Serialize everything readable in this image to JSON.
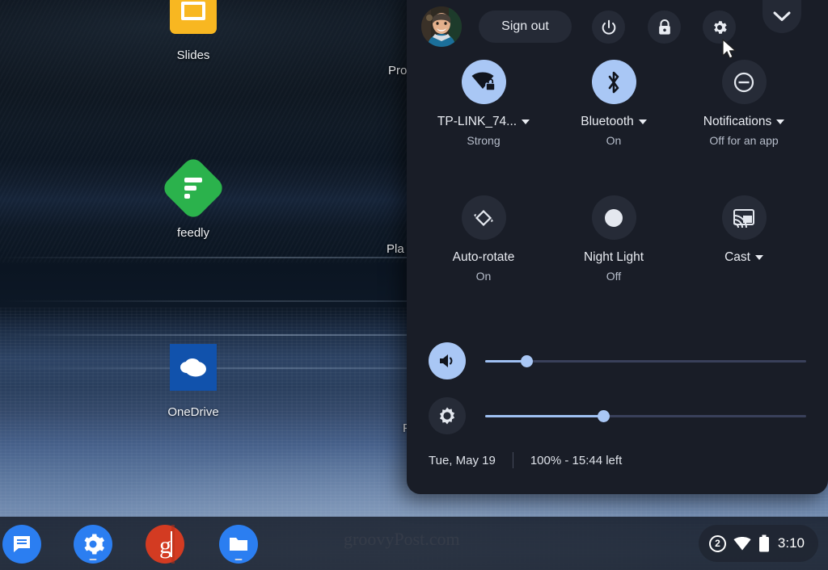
{
  "desktop": {
    "icons": [
      {
        "name": "Slides",
        "icon": "google-slides-icon"
      },
      {
        "name": "feedly",
        "icon": "feedly-icon"
      },
      {
        "name": "OneDrive",
        "icon": "onedrive-icon"
      }
    ],
    "clipped_labels": [
      "Pro",
      "Pla",
      "P"
    ],
    "watermark": "groovyPost.com"
  },
  "shelf": {
    "apps": [
      {
        "name": "Messages",
        "icon": "messages-icon"
      },
      {
        "name": "Settings",
        "icon": "settings-gear-icon"
      },
      {
        "name": "groovyPost",
        "icon": "groovypost-g-icon"
      },
      {
        "name": "Files",
        "icon": "files-folder-icon"
      }
    ],
    "status_tray": {
      "notification_count": "2",
      "network_icon": "wifi-icon",
      "battery_icon": "battery-icon",
      "clock": "3:10"
    }
  },
  "quick_settings": {
    "top_bar": {
      "avatar_label": "user-avatar",
      "sign_out_label": "Sign out",
      "power_label": "power-icon",
      "lock_label": "lock-icon",
      "settings_label": "gear-icon",
      "collapse_label": "chevron-down-icon"
    },
    "tiles": [
      {
        "label": "TP-LINK_74...",
        "sub": "Strong",
        "state": "on",
        "icon": "wifi-locked-icon",
        "has_caret": true
      },
      {
        "label": "Bluetooth",
        "sub": "On",
        "state": "on",
        "icon": "bluetooth-icon",
        "has_caret": true
      },
      {
        "label": "Notifications",
        "sub": "Off for an app",
        "state": "off",
        "icon": "do-not-disturb-icon",
        "has_caret": true
      },
      {
        "label": "Auto-rotate",
        "sub": "On",
        "state": "off",
        "icon": "auto-rotate-icon",
        "has_caret": false
      },
      {
        "label": "Night Light",
        "sub": "Off",
        "state": "off",
        "icon": "night-light-icon",
        "has_caret": false
      },
      {
        "label": "Cast",
        "sub": "",
        "state": "off",
        "icon": "cast-icon",
        "has_caret": true
      }
    ],
    "sliders": [
      {
        "name": "volume",
        "icon": "volume-icon",
        "value": 13,
        "state": "on"
      },
      {
        "name": "brightness",
        "icon": "brightness-icon",
        "value": 37,
        "state": "off"
      }
    ],
    "footer": {
      "date": "Tue, May 19",
      "battery": "100% - 15:44 left"
    }
  },
  "colors": {
    "panel_bg": "#191d27",
    "tile_on": "#a9c7f5",
    "tile_off": "#262b37",
    "accent": "#9fc0f2",
    "text": "#e9ecf2"
  }
}
